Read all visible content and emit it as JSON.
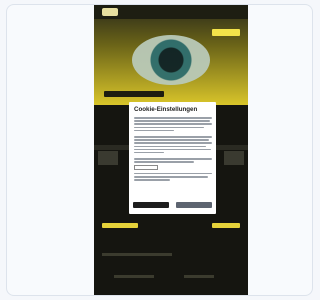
{
  "cookie_dialog": {
    "title": "Cookie-Einstellungen"
  }
}
